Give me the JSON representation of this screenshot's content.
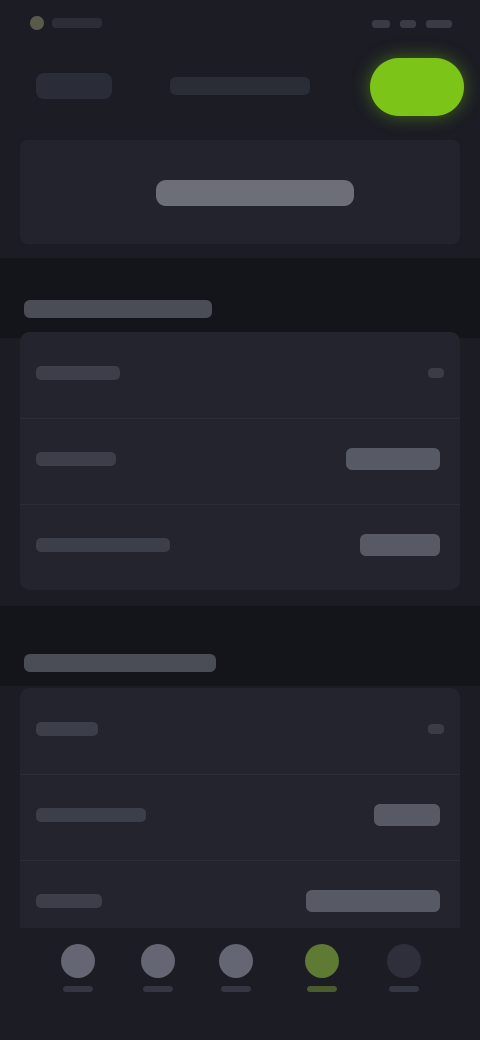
{
  "theme": {
    "background": "#1b1c24",
    "card": "#23242e",
    "accent": "#7cc417"
  },
  "status_bar": {
    "icons": [
      "app-icon",
      "signal-icon",
      "wifi-icon",
      "battery-icon"
    ]
  },
  "nav": {
    "back_label": "",
    "title": "",
    "action_label": ""
  },
  "hero": {
    "label": ""
  },
  "sections": [
    {
      "title": "",
      "rows": [
        {
          "label": "",
          "value": ""
        },
        {
          "label": "",
          "value": ""
        },
        {
          "label": "",
          "value": ""
        }
      ]
    },
    {
      "title": "",
      "rows": [
        {
          "label": "",
          "value": ""
        },
        {
          "label": "",
          "value": ""
        },
        {
          "label": "",
          "value": ""
        }
      ]
    }
  ],
  "tab_bar": {
    "tabs": [
      {
        "icon": "home-icon",
        "label": ""
      },
      {
        "icon": "search-icon",
        "label": ""
      },
      {
        "icon": "list-icon",
        "label": ""
      },
      {
        "icon": "settings-icon",
        "label": "",
        "active": true
      },
      {
        "icon": "more-icon",
        "label": ""
      }
    ]
  }
}
